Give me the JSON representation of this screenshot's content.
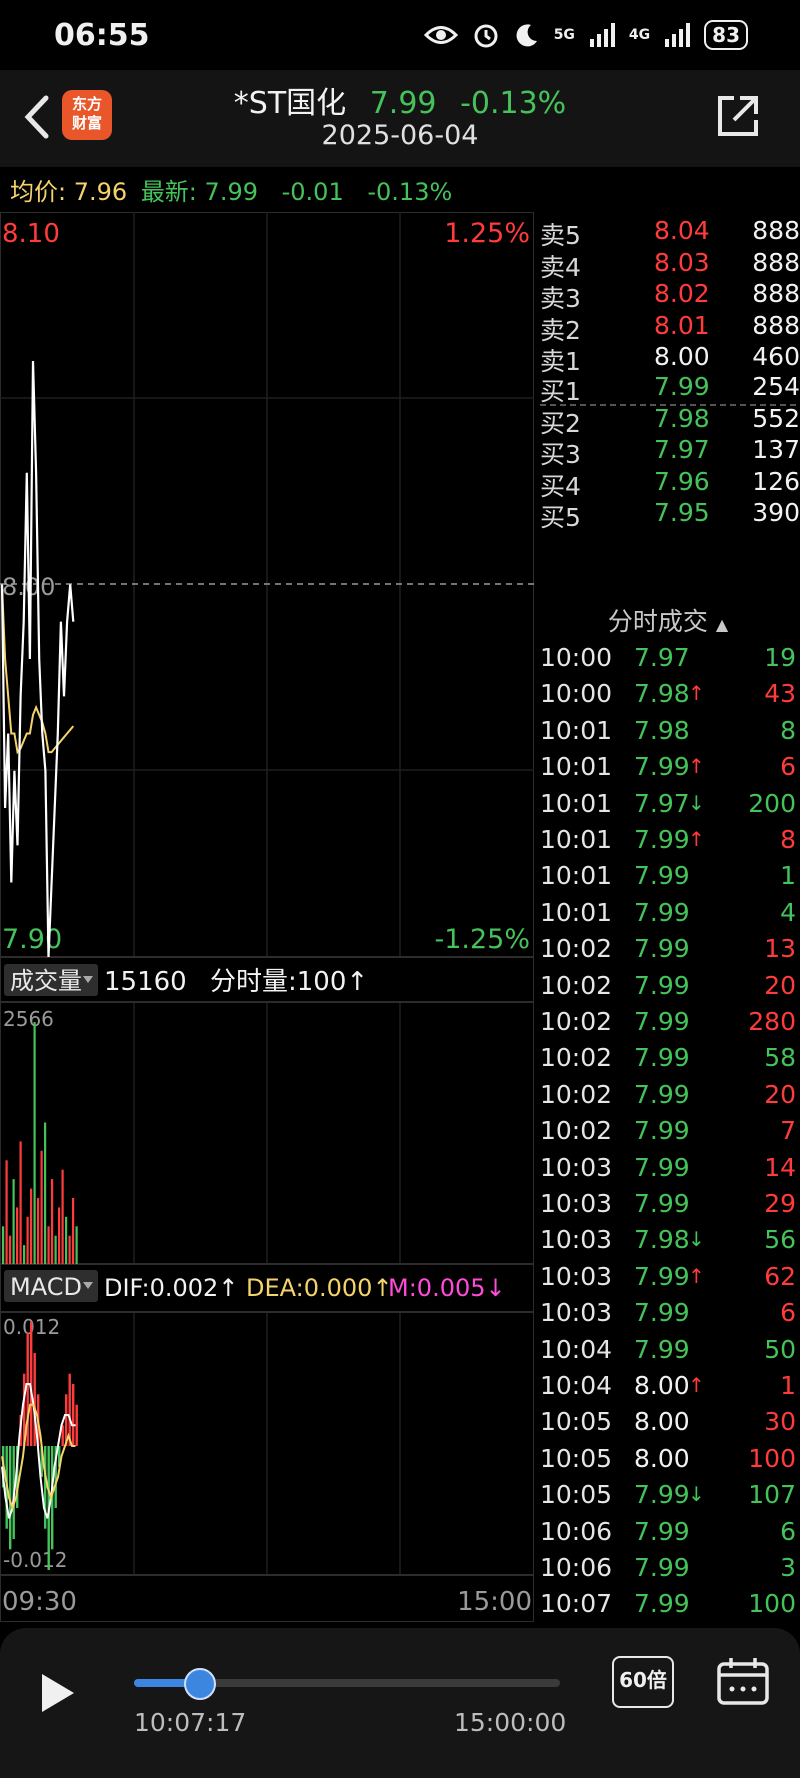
{
  "status_bar": {
    "time": "06:55",
    "battery": "83",
    "network1": "5G",
    "network2": "4G"
  },
  "header": {
    "logo_line1": "东方",
    "logo_line2": "财富",
    "stock_name": "*ST国化",
    "price": "7.99",
    "change_pct": "-0.13%",
    "date": "2025-06-04"
  },
  "info_line": {
    "avg_label": "均价:",
    "avg_value": "7.96",
    "latest_label": "最新:",
    "latest_value": "7.99",
    "change": "-0.01",
    "change_pct": "-0.13%"
  },
  "price_chart": {
    "high_price": "8.10",
    "high_pct": "1.25%",
    "low_price": "7.90",
    "low_pct": "-1.25%",
    "ref_price": "8.00",
    "series_price": [
      8.0,
      7.94,
      7.96,
      7.92,
      7.95,
      7.93,
      7.97,
      7.99,
      8.03,
      7.98,
      8.06,
      8.03,
      7.98,
      7.96,
      7.95,
      7.9,
      7.92,
      7.94,
      7.96,
      7.99,
      7.97,
      7.99,
      8.0,
      7.99
    ],
    "series_avg": [
      8.0,
      7.98,
      7.97,
      7.96,
      7.96,
      7.955,
      7.956,
      7.958,
      7.96,
      7.96,
      7.965,
      7.967,
      7.965,
      7.963,
      7.96,
      7.955,
      7.955,
      7.956,
      7.957,
      7.958,
      7.959,
      7.96,
      7.961,
      7.962
    ],
    "colors": {
      "price_line": "#ffffff",
      "avg_line": "#f5d36b",
      "ref_line": "#9a9a9a"
    }
  },
  "volume": {
    "selector": "成交量",
    "total": "15160",
    "per_minute_label": "分时量:100",
    "max_label": "2566"
  },
  "macd": {
    "selector": "MACD",
    "dif": "DIF:0.002",
    "dea": "DEA:0.000",
    "m": "M:0.005",
    "top_label": "0.012",
    "bottom_label": "-0.012"
  },
  "time_axis": {
    "start": "09:30",
    "end": "15:00"
  },
  "order_book": {
    "asks": [
      {
        "label": "卖5",
        "price": "8.04",
        "volume": "888"
      },
      {
        "label": "卖4",
        "price": "8.03",
        "volume": "888"
      },
      {
        "label": "卖3",
        "price": "8.02",
        "volume": "888"
      },
      {
        "label": "卖2",
        "price": "8.01",
        "volume": "888"
      },
      {
        "label": "卖1",
        "price": "8.00",
        "volume": "460"
      }
    ],
    "bids": [
      {
        "label": "买1",
        "price": "7.99",
        "volume": "254"
      },
      {
        "label": "买2",
        "price": "7.98",
        "volume": "552"
      },
      {
        "label": "买3",
        "price": "7.97",
        "volume": "137"
      },
      {
        "label": "买4",
        "price": "7.96",
        "volume": "126"
      },
      {
        "label": "买5",
        "price": "7.95",
        "volume": "390"
      }
    ]
  },
  "trades_title": "分时成交",
  "trades": [
    {
      "time": "10:00",
      "price": "7.97",
      "arrow": "",
      "volume": "19"
    },
    {
      "time": "10:00",
      "price": "7.98",
      "arrow": "↑",
      "volume": "43"
    },
    {
      "time": "10:01",
      "price": "7.98",
      "arrow": "",
      "volume": "8"
    },
    {
      "time": "10:01",
      "price": "7.99",
      "arrow": "↑",
      "volume": "6"
    },
    {
      "time": "10:01",
      "price": "7.97",
      "arrow": "↓",
      "volume": "200"
    },
    {
      "time": "10:01",
      "price": "7.99",
      "arrow": "↑",
      "volume": "8"
    },
    {
      "time": "10:01",
      "price": "7.99",
      "arrow": "",
      "volume": "1"
    },
    {
      "time": "10:01",
      "price": "7.99",
      "arrow": "",
      "volume": "4"
    },
    {
      "time": "10:02",
      "price": "7.99",
      "arrow": "",
      "volume": "13"
    },
    {
      "time": "10:02",
      "price": "7.99",
      "arrow": "",
      "volume": "20"
    },
    {
      "time": "10:02",
      "price": "7.99",
      "arrow": "",
      "volume": "280"
    },
    {
      "time": "10:02",
      "price": "7.99",
      "arrow": "",
      "volume": "58"
    },
    {
      "time": "10:02",
      "price": "7.99",
      "arrow": "",
      "volume": "20"
    },
    {
      "time": "10:02",
      "price": "7.99",
      "arrow": "",
      "volume": "7"
    },
    {
      "time": "10:03",
      "price": "7.99",
      "arrow": "",
      "volume": "14"
    },
    {
      "time": "10:03",
      "price": "7.99",
      "arrow": "",
      "volume": "29"
    },
    {
      "time": "10:03",
      "price": "7.98",
      "arrow": "↓",
      "volume": "56"
    },
    {
      "time": "10:03",
      "price": "7.99",
      "arrow": "↑",
      "volume": "62"
    },
    {
      "time": "10:03",
      "price": "7.99",
      "arrow": "",
      "volume": "6"
    },
    {
      "time": "10:04",
      "price": "7.99",
      "arrow": "",
      "volume": "50"
    },
    {
      "time": "10:04",
      "price": "8.00",
      "arrow": "↑",
      "volume": "1"
    },
    {
      "time": "10:05",
      "price": "8.00",
      "arrow": "",
      "volume": "30"
    },
    {
      "time": "10:05",
      "price": "8.00",
      "arrow": "",
      "volume": "100"
    },
    {
      "time": "10:05",
      "price": "7.99",
      "arrow": "↓",
      "volume": "107"
    },
    {
      "time": "10:06",
      "price": "7.99",
      "arrow": "",
      "volume": "6"
    },
    {
      "time": "10:06",
      "price": "7.99",
      "arrow": "",
      "volume": "3"
    },
    {
      "time": "10:07",
      "price": "7.99",
      "arrow": "",
      "volume": "100"
    }
  ],
  "trade_volume_colors": [
    "green",
    "red",
    "green",
    "red",
    "green",
    "red",
    "green",
    "green",
    "red",
    "red",
    "red",
    "green",
    "red",
    "red",
    "red",
    "red",
    "green",
    "red",
    "red",
    "green",
    "red",
    "red",
    "red",
    "green",
    "green",
    "green",
    "green"
  ],
  "playback": {
    "current_time": "10:07:17",
    "end_time": "15:00:00",
    "speed": "60倍",
    "progress": 0.155
  }
}
